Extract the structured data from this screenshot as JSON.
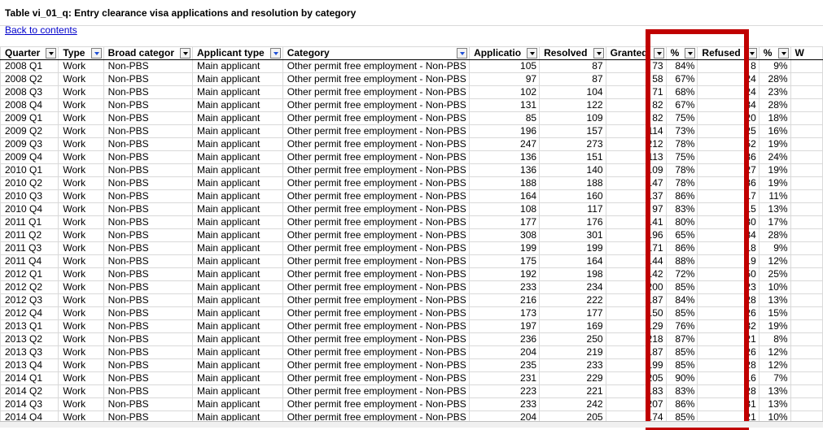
{
  "sheet": {
    "title": "Table vi_01_q: Entry clearance visa applications and resolution by category",
    "back_link": "Back to contents",
    "headers": [
      "Quarter",
      "Type",
      "Broad categor",
      "Applicant type",
      "Category",
      "Applicatio",
      "Resolved",
      "Granted",
      "%",
      "Refused",
      "%",
      "W"
    ],
    "active_filter_columns": [
      "Type",
      "Applicant type",
      "Category"
    ],
    "rows": [
      [
        "2008 Q1",
        "Work",
        "Non-PBS",
        "Main applicant",
        "Other permit free employment - Non-PBS",
        "105",
        "87",
        "73",
        "84%",
        "8",
        "9%"
      ],
      [
        "2008 Q2",
        "Work",
        "Non-PBS",
        "Main applicant",
        "Other permit free employment - Non-PBS",
        "97",
        "87",
        "58",
        "67%",
        "24",
        "28%"
      ],
      [
        "2008 Q3",
        "Work",
        "Non-PBS",
        "Main applicant",
        "Other permit free employment - Non-PBS",
        "102",
        "104",
        "71",
        "68%",
        "24",
        "23%"
      ],
      [
        "2008 Q4",
        "Work",
        "Non-PBS",
        "Main applicant",
        "Other permit free employment - Non-PBS",
        "131",
        "122",
        "82",
        "67%",
        "34",
        "28%"
      ],
      [
        "2009 Q1",
        "Work",
        "Non-PBS",
        "Main applicant",
        "Other permit free employment - Non-PBS",
        "85",
        "109",
        "82",
        "75%",
        "20",
        "18%"
      ],
      [
        "2009 Q2",
        "Work",
        "Non-PBS",
        "Main applicant",
        "Other permit free employment - Non-PBS",
        "196",
        "157",
        "114",
        "73%",
        "25",
        "16%"
      ],
      [
        "2009 Q3",
        "Work",
        "Non-PBS",
        "Main applicant",
        "Other permit free employment - Non-PBS",
        "247",
        "273",
        "212",
        "78%",
        "52",
        "19%"
      ],
      [
        "2009 Q4",
        "Work",
        "Non-PBS",
        "Main applicant",
        "Other permit free employment - Non-PBS",
        "136",
        "151",
        "113",
        "75%",
        "36",
        "24%"
      ],
      [
        "2010 Q1",
        "Work",
        "Non-PBS",
        "Main applicant",
        "Other permit free employment - Non-PBS",
        "136",
        "140",
        "109",
        "78%",
        "27",
        "19%"
      ],
      [
        "2010 Q2",
        "Work",
        "Non-PBS",
        "Main applicant",
        "Other permit free employment - Non-PBS",
        "188",
        "188",
        "147",
        "78%",
        "36",
        "19%"
      ],
      [
        "2010 Q3",
        "Work",
        "Non-PBS",
        "Main applicant",
        "Other permit free employment - Non-PBS",
        "164",
        "160",
        "137",
        "86%",
        "17",
        "11%"
      ],
      [
        "2010 Q4",
        "Work",
        "Non-PBS",
        "Main applicant",
        "Other permit free employment - Non-PBS",
        "108",
        "117",
        "97",
        "83%",
        "15",
        "13%"
      ],
      [
        "2011 Q1",
        "Work",
        "Non-PBS",
        "Main applicant",
        "Other permit free employment - Non-PBS",
        "177",
        "176",
        "141",
        "80%",
        "30",
        "17%"
      ],
      [
        "2011 Q2",
        "Work",
        "Non-PBS",
        "Main applicant",
        "Other permit free employment - Non-PBS",
        "308",
        "301",
        "196",
        "65%",
        "84",
        "28%"
      ],
      [
        "2011 Q3",
        "Work",
        "Non-PBS",
        "Main applicant",
        "Other permit free employment - Non-PBS",
        "199",
        "199",
        "171",
        "86%",
        "18",
        "9%"
      ],
      [
        "2011 Q4",
        "Work",
        "Non-PBS",
        "Main applicant",
        "Other permit free employment - Non-PBS",
        "175",
        "164",
        "144",
        "88%",
        "19",
        "12%"
      ],
      [
        "2012 Q1",
        "Work",
        "Non-PBS",
        "Main applicant",
        "Other permit free employment - Non-PBS",
        "192",
        "198",
        "142",
        "72%",
        "50",
        "25%"
      ],
      [
        "2012 Q2",
        "Work",
        "Non-PBS",
        "Main applicant",
        "Other permit free employment - Non-PBS",
        "233",
        "234",
        "200",
        "85%",
        "23",
        "10%"
      ],
      [
        "2012 Q3",
        "Work",
        "Non-PBS",
        "Main applicant",
        "Other permit free employment - Non-PBS",
        "216",
        "222",
        "187",
        "84%",
        "28",
        "13%"
      ],
      [
        "2012 Q4",
        "Work",
        "Non-PBS",
        "Main applicant",
        "Other permit free employment - Non-PBS",
        "173",
        "177",
        "150",
        "85%",
        "26",
        "15%"
      ],
      [
        "2013 Q1",
        "Work",
        "Non-PBS",
        "Main applicant",
        "Other permit free employment - Non-PBS",
        "197",
        "169",
        "129",
        "76%",
        "32",
        "19%"
      ],
      [
        "2013 Q2",
        "Work",
        "Non-PBS",
        "Main applicant",
        "Other permit free employment - Non-PBS",
        "236",
        "250",
        "218",
        "87%",
        "21",
        "8%"
      ],
      [
        "2013 Q3",
        "Work",
        "Non-PBS",
        "Main applicant",
        "Other permit free employment - Non-PBS",
        "204",
        "219",
        "187",
        "85%",
        "26",
        "12%"
      ],
      [
        "2013 Q4",
        "Work",
        "Non-PBS",
        "Main applicant",
        "Other permit free employment - Non-PBS",
        "235",
        "233",
        "199",
        "85%",
        "28",
        "12%"
      ],
      [
        "2014 Q1",
        "Work",
        "Non-PBS",
        "Main applicant",
        "Other permit free employment - Non-PBS",
        "231",
        "229",
        "205",
        "90%",
        "16",
        "7%"
      ],
      [
        "2014 Q2",
        "Work",
        "Non-PBS",
        "Main applicant",
        "Other permit free employment - Non-PBS",
        "223",
        "221",
        "183",
        "83%",
        "28",
        "13%"
      ],
      [
        "2014 Q3",
        "Work",
        "Non-PBS",
        "Main applicant",
        "Other permit free employment - Non-PBS",
        "233",
        "242",
        "207",
        "86%",
        "31",
        "13%"
      ],
      [
        "2014 Q4",
        "Work",
        "Non-PBS",
        "Main applicant",
        "Other permit free employment - Non-PBS",
        "204",
        "205",
        "174",
        "85%",
        "21",
        "10%"
      ]
    ]
  },
  "colors": {
    "highlight": "#c00000",
    "link": "#0000cc",
    "active_filter": "#1f4fd6"
  },
  "icons": {
    "filter": "filter-dropdown-icon"
  }
}
